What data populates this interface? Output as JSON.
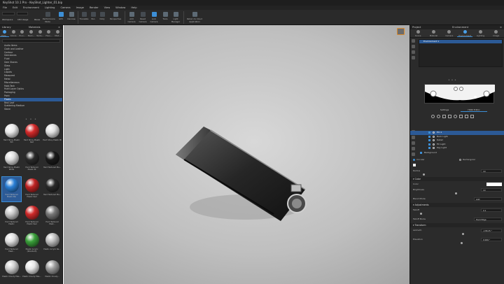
{
  "window": {
    "title": "KeyShot 10.1 Pro - KeyShot_Lighter_01.bip"
  },
  "menu": [
    "File",
    "Edit",
    "Environment",
    "Lighting",
    "Camera",
    "Image",
    "Render",
    "View",
    "Window",
    "Help"
  ],
  "toolbar": {
    "workspace_label": "Workspace",
    "cpu_usage_label": "CPU Usage",
    "pause_label": "Pause",
    "buttons": [
      "Performance Mode",
      "GPU",
      "Denoise",
      "Translate",
      "Pan",
      "Dolly",
      "Perspective",
      "Add Camera",
      "Reset Camera",
      "Lock Camera",
      "Tools",
      "Light Manager",
      "Return to Cloud Application"
    ]
  },
  "left_panel": {
    "title": "Library",
    "subtitle": "Materials",
    "tabs": [
      "Mate...",
      "Colors",
      "Envi...",
      "Back...",
      "Textu...",
      "Favo...",
      "Mod..."
    ],
    "tree": [
      "Audio Items",
      "Cloth and Leather",
      "Contour",
      "Gemstones",
      "Fluid",
      "Gem Stones",
      "Glass",
      "Light",
      "Liquids",
      "Measured",
      "Metal",
      "Miscellaneous",
      "Mold-Tech",
      "Multi Layer Optics",
      "Packaging",
      "Paint",
      "Plastic",
      "Real Leaf",
      "Scattering Medium",
      "Stone"
    ],
    "selected_tree": "Plastic",
    "swatches": [
      {
        "label": "Hard Shiny Plastic Wh",
        "color": "#e8e8e8"
      },
      {
        "label": "Hard Shiny Plastic Red",
        "color": "#d42a2a"
      },
      {
        "label": "Hard Shiny Plastic Bl",
        "color": "#e0e0e0"
      },
      {
        "label": "Hard Shiny Plastic White",
        "color": "#dcdcdc"
      },
      {
        "label": "Hard Textured Plastic Bl",
        "color": "#2a2a2a"
      },
      {
        "label": "Hard Textured Pla...",
        "color": "#1a1a1a"
      },
      {
        "label": "Hard Textured Plastic Blu",
        "color": "#2a7fd6"
      },
      {
        "label": "Hard Textured Plastic Red",
        "color": "#c02424"
      },
      {
        "label": "Hard Textured Pla...",
        "color": "#2a2a2a"
      },
      {
        "label": "Hard Textured Plastic",
        "color": "#c8c8c8"
      },
      {
        "label": "Hard Textured Plastic Red",
        "color": "#d02a2a"
      },
      {
        "label": "Hard Textured Plast...",
        "color": "#777777"
      },
      {
        "label": "Hard Textured Plast...",
        "color": "#e0e0e0"
      },
      {
        "label": "Plastic Acrylic (Standard)",
        "color": "#3aa03a"
      },
      {
        "label": "Plastic Acrylic Re...",
        "color": "#bdbdbd"
      },
      {
        "label": "Plastic Cloudy Plas...",
        "color": "#cfcfcf"
      },
      {
        "label": "Plastic Cloudy Plas...",
        "color": "#e6e6e6"
      },
      {
        "label": "Plastic Cloudy...",
        "color": "#9b9b9b"
      }
    ],
    "selected_swatch": 6
  },
  "right_panel": {
    "title": "Project",
    "subtitle": "Environment",
    "tabs": [
      "Scene",
      "Material",
      "Camera",
      "Environment",
      "Lighting",
      "Image"
    ],
    "environment_name": "Environment 1",
    "subtabs": [
      "Settings",
      "HDRI Editor"
    ],
    "pins": [
      "Pin 1",
      "Back Light",
      "Detail",
      "Fill Light",
      "Key Light"
    ],
    "selected_pin": "Pin 1",
    "background_label": "Background",
    "shape_options": [
      "Circular",
      "Rectangular"
    ],
    "shape_selected": "Circular",
    "radius_label": "Radius",
    "radius_value": "10",
    "color_section": "Color",
    "color_label": "Color",
    "brightness_label": "Brightness",
    "brightness_value": "10",
    "blend_mode_label": "Blend Mode",
    "blend_mode_value": "Add",
    "adjustments_section": "Adjustments",
    "falloff_label": "Falloff",
    "falloff_value": "0.1",
    "falloff_mode_label": "Falloff Mode",
    "falloff_mode_value": "Hard Edge",
    "transform_section": "Transform",
    "azimuth_label": "Azimuth",
    "azimuth_value": "-138.25 °",
    "elevation_label": "Elevation",
    "elevation_value": "9.999 °"
  },
  "colors": {
    "accent": "#3d8fd6",
    "selection": "#2c5a96",
    "panel_bg": "#2b2b2b"
  }
}
